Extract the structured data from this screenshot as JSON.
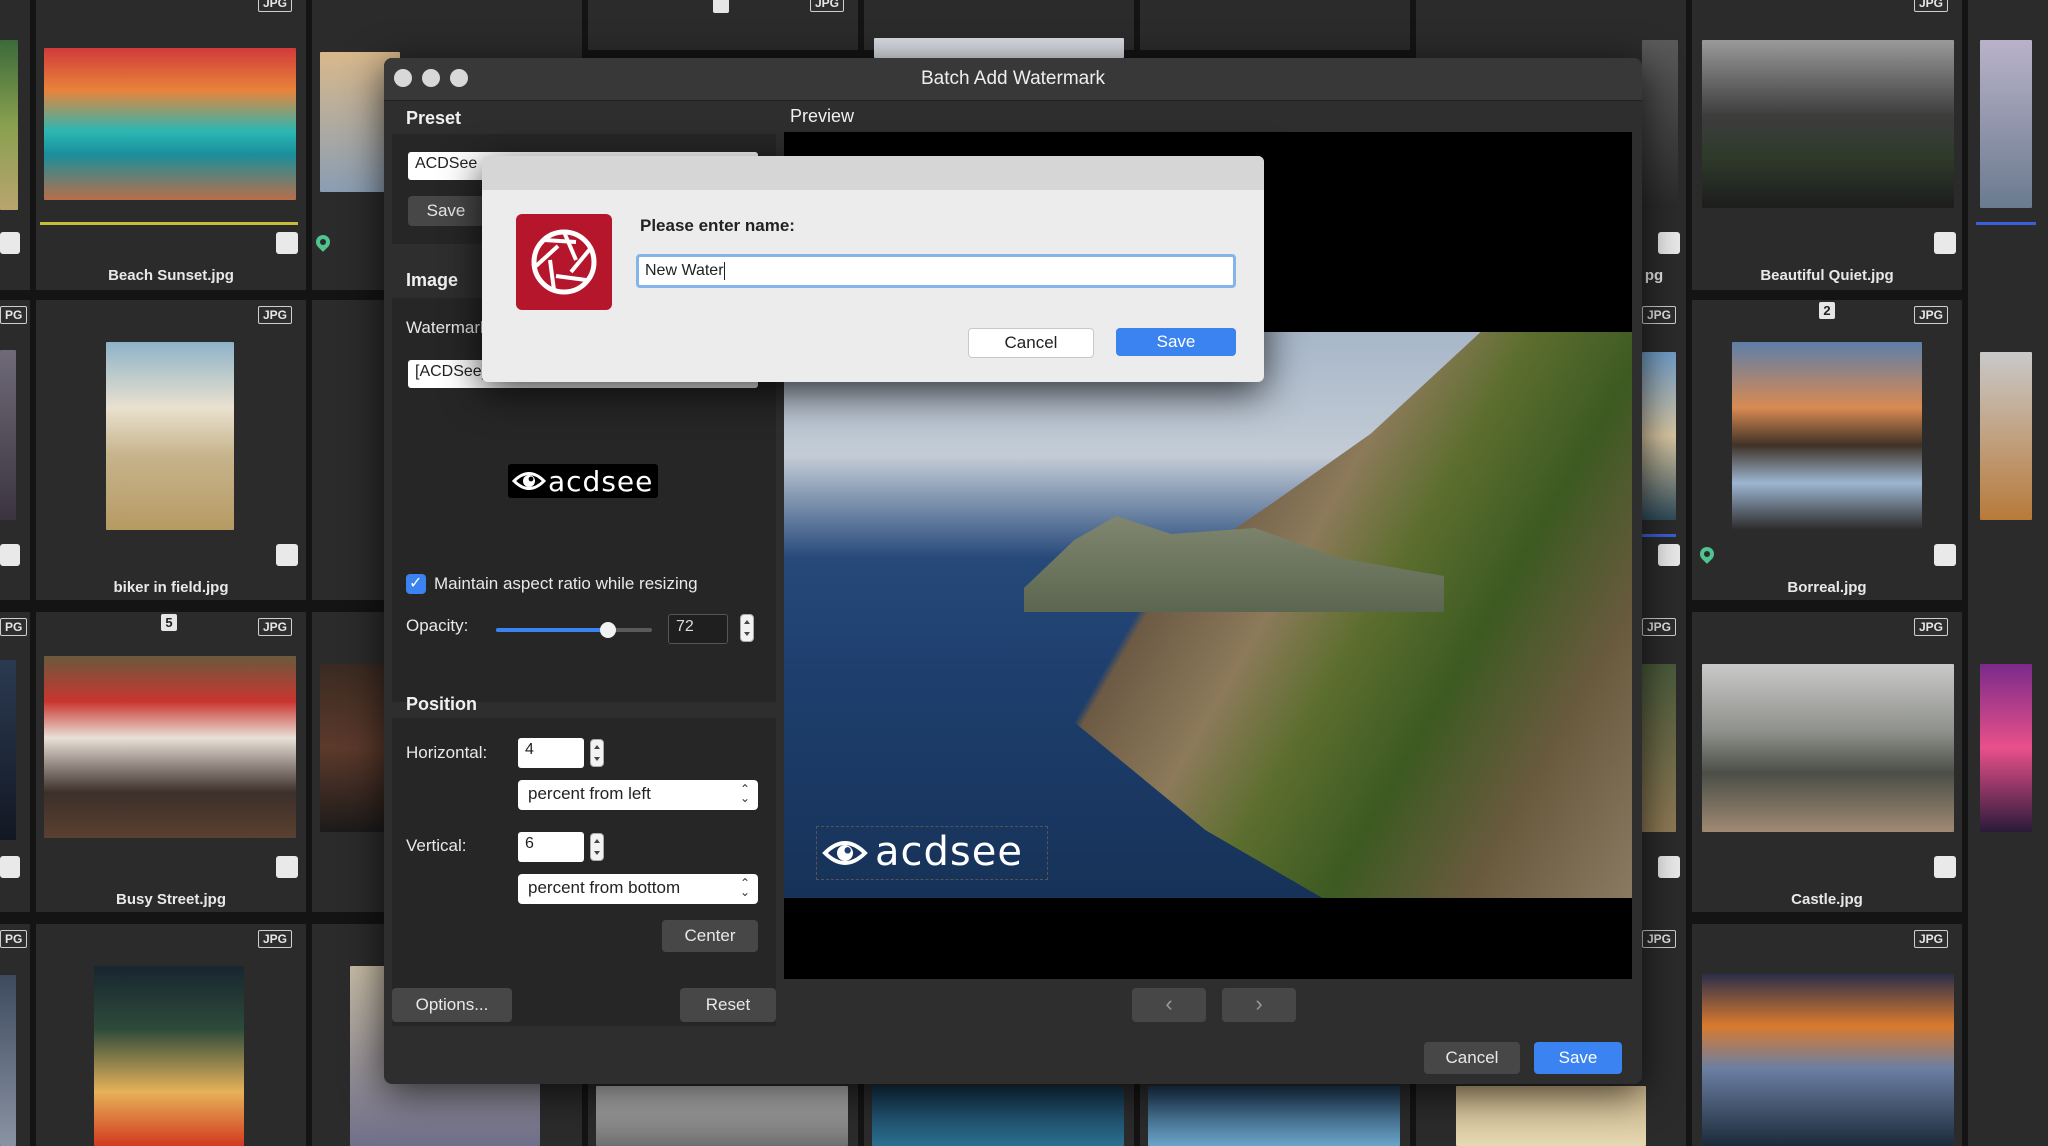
{
  "browser": {
    "thumbnails": [
      {
        "name": "Beach Sunset.jpg",
        "badge": "JPG"
      },
      {
        "name": "Beautiful Quiet.jpg",
        "badge": "JPG"
      },
      {
        "name": "biker in field.jpg",
        "badge": "JPG"
      },
      {
        "name": "Borreal.jpg",
        "badge": "JPG",
        "number": "2"
      },
      {
        "name": "Busy Street.jpg",
        "badge": "JPG",
        "number": "5"
      },
      {
        "name": "Castle.jpg",
        "badge": "JPG"
      },
      {
        "name": "",
        "badge": "JPG"
      },
      {
        "name": "",
        "badge": "JPG"
      }
    ],
    "partial_labels": {
      "left_badge": "PG",
      "right_partial_name": "pg",
      "right_badge": "JPG"
    }
  },
  "dialog": {
    "title": "Batch Add Watermark",
    "preset": {
      "section_label": "Preset",
      "selected_value": "ACDSee",
      "save_label": "Save"
    },
    "image": {
      "section_label": "Image",
      "watermark_label": "Watermark",
      "watermark_value": "[ACDSee]",
      "logo_text": "acdsee"
    },
    "maintain_aspect": {
      "label": "Maintain aspect ratio while resizing",
      "checked": true
    },
    "opacity": {
      "label": "Opacity:",
      "value": "72",
      "fraction": 0.72
    },
    "position": {
      "section_label": "Position",
      "horizontal_label": "Horizontal:",
      "horizontal_value": "4",
      "horizontal_mode": "percent from left",
      "vertical_label": "Vertical:",
      "vertical_value": "6",
      "vertical_mode": "percent from bottom",
      "center_label": "Center"
    },
    "preview": {
      "section_label": "Preview",
      "watermark_text": "acdsee"
    },
    "footer": {
      "options_label": "Options...",
      "reset_label": "Reset",
      "prev_label": "‹",
      "next_label": "›",
      "cancel_label": "Cancel",
      "save_label": "Save"
    }
  },
  "prompt": {
    "question": "Please enter name:",
    "input_value": "New Water",
    "cancel_label": "Cancel",
    "save_label": "Save",
    "app_icon": "acdsee-aperture-icon"
  },
  "colors": {
    "accent": "#3a83f0",
    "app_icon_red": "#b5162b",
    "pin_green": "#4fc48f"
  }
}
